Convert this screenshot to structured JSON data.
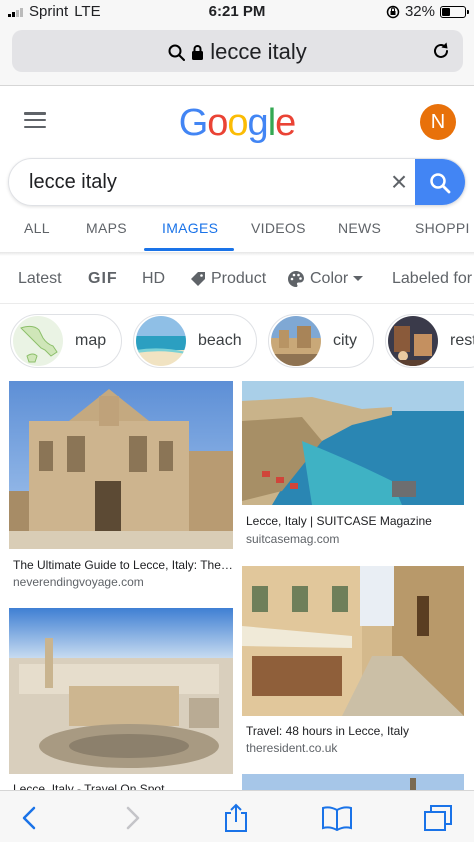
{
  "status_bar": {
    "carrier": "Sprint",
    "network": "LTE",
    "time": "6:21 PM",
    "battery": "32%"
  },
  "browser": {
    "url_text": "lecce italy",
    "lock_icon": "lock-icon",
    "search_icon": "magnifier-icon",
    "reload_icon": "reload-icon"
  },
  "google": {
    "logo": "Google",
    "logo_colors": [
      "#4285F4",
      "#EA4335",
      "#FBBC05",
      "#4285F4",
      "#34A853",
      "#EA4335"
    ],
    "avatar_letter": "N",
    "avatar_color": "#E8710A",
    "search_query": "lecce italy",
    "clear_symbol": "×"
  },
  "tabs": [
    "ALL",
    "MAPS",
    "IMAGES",
    "VIDEOS",
    "NEWS",
    "SHOPPI"
  ],
  "active_tab": "IMAGES",
  "filters": [
    "Latest",
    "GIF",
    "HD",
    "Product",
    "Color",
    "Labeled for"
  ],
  "chips": [
    "map",
    "beach",
    "city",
    "rest"
  ],
  "results": [
    {
      "title": "The Ultimate Guide to Lecce, Italy: The…",
      "source": "neverendingvoyage.com"
    },
    {
      "title": "Lecce, Italy | SUITCASE Magazine",
      "source": "suitcasemag.com"
    },
    {
      "title": "Travel: 48 hours in Lecce, Italy",
      "source": "theresident.co.uk"
    },
    {
      "title": "Lecce, Italy - Travel On Spot",
      "source": ""
    }
  ],
  "toolbar": {
    "back_icon": "back-icon",
    "forward_icon": "forward-icon",
    "share_icon": "share-icon",
    "bookmarks_icon": "bookmarks-icon",
    "tabs_icon": "tabs-icon"
  },
  "accent_color": "#1A73E8"
}
